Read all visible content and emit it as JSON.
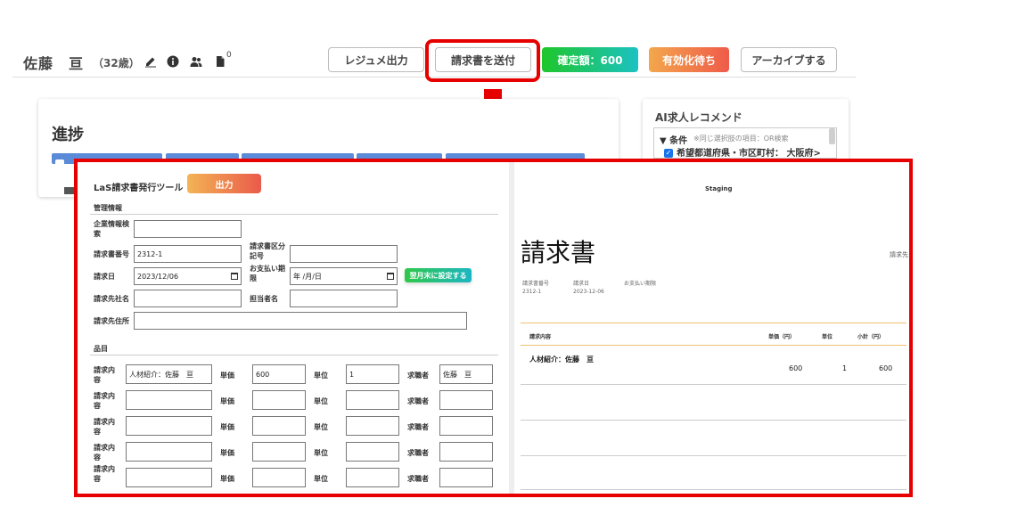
{
  "header": {
    "name": "佐藤　亘",
    "age": "（32歳）",
    "doc_count": "0",
    "icons": [
      "edit-icon",
      "info-icon",
      "users-icon",
      "document-icon"
    ],
    "buttons": {
      "resume": "レジュメ出力",
      "send_invoice": "請求書を送付",
      "confirmed": "確定額：600",
      "pending": "有効化待ち",
      "archive": "アーカイブする"
    }
  },
  "progress": {
    "title": "進捗"
  },
  "ai_recommend": {
    "title": "AI求人レコメンド",
    "condition_label": "▼ 条件",
    "condition_note": "※同じ選択肢の項目：OR検索",
    "checkbox_text": "希望都道府県・市区町村： 大阪府>"
  },
  "invoice_tool": {
    "title": "LaS請求書発行ツール",
    "output_button": "出力",
    "management_section": "管理情報",
    "fields": {
      "company_search_label": "企業情報検索",
      "company_search_value": "",
      "invoice_no_label": "請求書番号",
      "invoice_no_value": "2312-1",
      "category_label": "請求書区分記号",
      "category_value": "",
      "invoice_date_label": "請求日",
      "invoice_date_value": "2023/12/06",
      "due_date_label": "お支払い期限",
      "due_date_value": "年 /月/日",
      "month_end_button": "翌月末に設定する",
      "client_name_label": "請求先社名",
      "client_name_value": "",
      "staff_label": "担当者名",
      "staff_value": "",
      "client_address_label": "請求先住所",
      "client_address_value": ""
    },
    "items_section": "品目",
    "item_labels": {
      "content": "請求内容",
      "unit_price": "単価",
      "unit": "単位",
      "applicant": "求職者"
    },
    "items": [
      {
        "content": "人材紹介：佐藤　亘",
        "unit_price": "600",
        "unit": "1",
        "applicant": "佐藤　亘"
      },
      {
        "content": "",
        "unit_price": "",
        "unit": "",
        "applicant": ""
      },
      {
        "content": "",
        "unit_price": "",
        "unit": "",
        "applicant": ""
      },
      {
        "content": "",
        "unit_price": "",
        "unit": "",
        "applicant": ""
      },
      {
        "content": "",
        "unit_price": "",
        "unit": "",
        "applicant": ""
      }
    ]
  },
  "preview": {
    "staging": "Staging",
    "title": "請求書",
    "to": "請求先",
    "meta_labels": [
      "請求書番号",
      "請求日",
      "お支払い期限"
    ],
    "meta_values": [
      "2312-1",
      "2023-12-06",
      ""
    ],
    "table_headers": [
      "請求内容",
      "単価（円）",
      "単位",
      "小計（円）"
    ],
    "row": {
      "content": "人材紹介：佐藤　亘",
      "unit_price": "600",
      "unit": "1",
      "subtotal": "600"
    }
  },
  "colors": {
    "callout": "#e60000",
    "confirmed_gradient": [
      "#1ec62b",
      "#1cc2c2"
    ],
    "pending_gradient": [
      "#f3a74c",
      "#ef5b4a"
    ],
    "stage_tab": "#5b8bd8"
  }
}
